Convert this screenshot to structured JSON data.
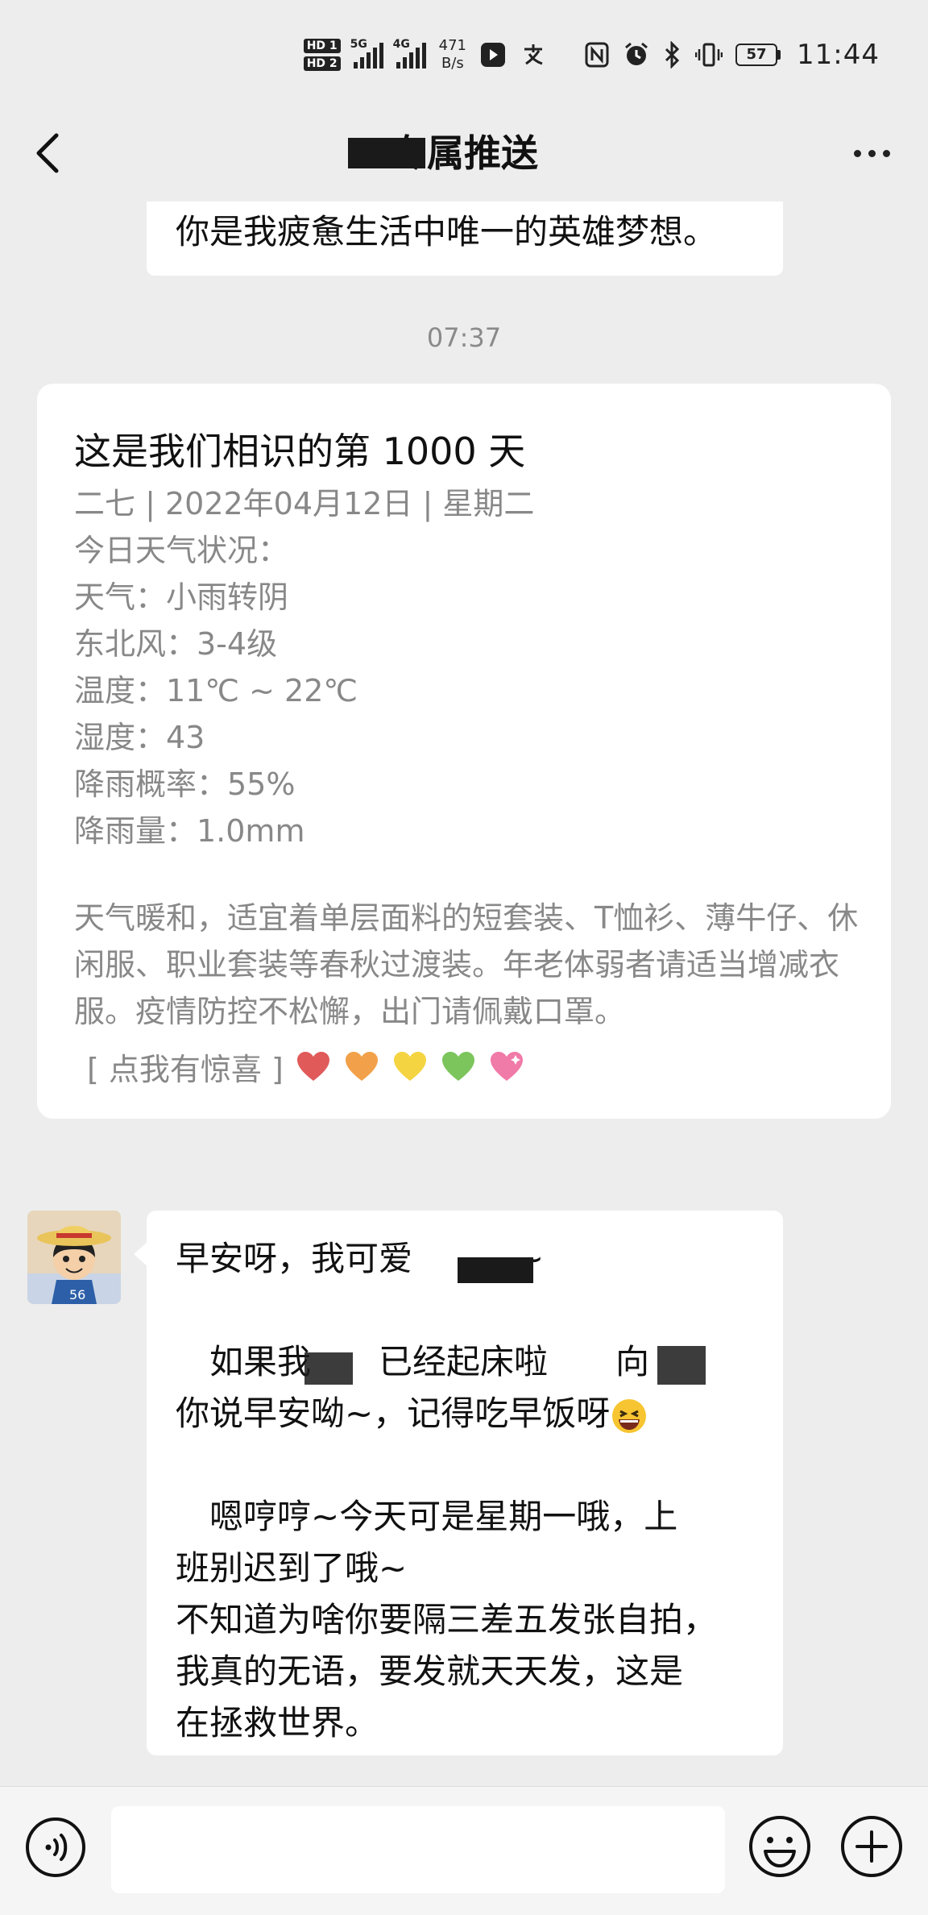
{
  "status_bar": {
    "hd1": "HD 1",
    "hd2": "HD 2",
    "signal1": "5G",
    "signal2": "4G",
    "speed_value": "471",
    "speed_unit": "B/s",
    "battery": "57",
    "time": "11:44"
  },
  "nav": {
    "title": "专属推送",
    "more_icon": "more-dots-icon",
    "back_icon": "chevron-left-icon"
  },
  "chat": {
    "prev_bubble_text": "你是我疲惫生活中唯一的英雄梦想。",
    "timestamp": "07:37",
    "card": {
      "title": "这是我们相识的第 1000 天",
      "lines": [
        "二七 | 2022年04月12日 | 星期二",
        "今日天气状况：",
        "天气：小雨转阴",
        "东北风：3-4级",
        "温度：11℃ ~ 22℃",
        "湿度：43",
        "降雨概率：55%",
        "降雨量：1.0mm"
      ],
      "paragraph": "天气暖和，适宜着单层面料的短套装、T恤衫、薄牛仔、休闲服、职业套装等春秋过渡装。年老体弱者请适当增减衣服。疫情防控不松懈，出门请佩戴口罩。",
      "surprise_label": "[ 点我有惊喜 ]",
      "hearts": [
        "#e05a5a",
        "#f2a14a",
        "#f5d442",
        "#7cc55c",
        "#f07aa8"
      ]
    },
    "message": {
      "line1": "早安呀，我可爱",
      "line1_tail": "~",
      "line2_a": "　如果我",
      "line2_b": "已经起床啦",
      "line2_c": "向",
      "line3": "你说早安呦~，记得吃早饭呀",
      "line4": "　嗯哼哼~今天可是星期一哦，上",
      "line5": "班别迟到了哦~",
      "line6": "不知道为啥你要隔三差五发张自拍，",
      "line7": "我真的无语，要发就天天发，这是",
      "line8": "在拯救世界。"
    }
  },
  "input_bar": {
    "placeholder": "",
    "voice_icon": "voice-icon",
    "emoji_icon": "emoji-icon",
    "plus_icon": "plus-icon"
  }
}
